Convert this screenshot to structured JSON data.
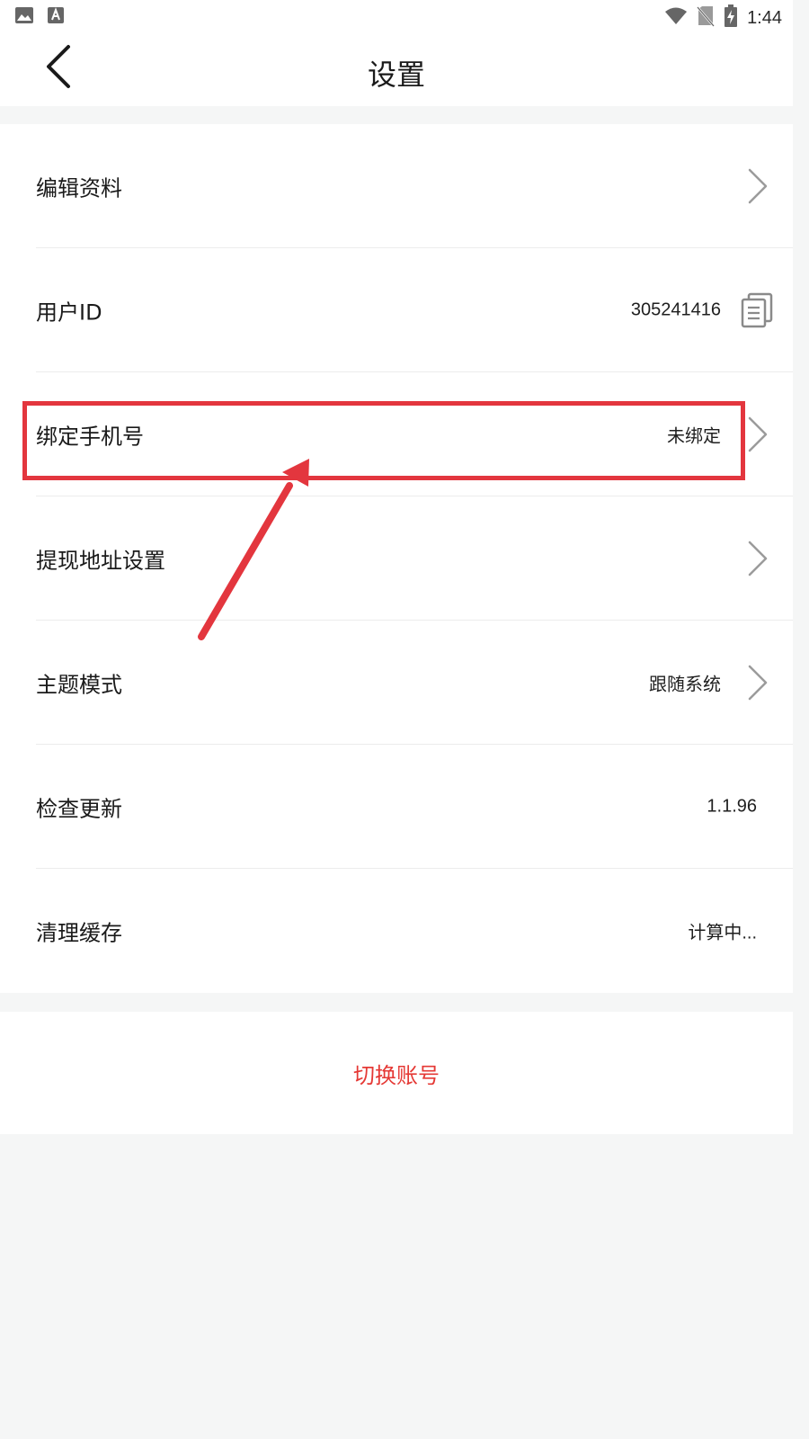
{
  "status_bar": {
    "time": "1:44",
    "left_icons": [
      "image-icon",
      "text-a-icon"
    ],
    "right_icons": [
      "wifi-icon",
      "no-sim-icon",
      "battery-charging-icon"
    ]
  },
  "header": {
    "title": "设置",
    "back_icon": "chevron-left-icon"
  },
  "settings": {
    "items": [
      {
        "label": "编辑资料",
        "value": "",
        "trailing": "chevron-right-icon"
      },
      {
        "label": "用户ID",
        "value": "305241416",
        "trailing": "copy-icon"
      },
      {
        "label": "绑定手机号",
        "value": "未绑定",
        "trailing": "chevron-right-icon"
      },
      {
        "label": "提现地址设置",
        "value": "",
        "trailing": "chevron-right-icon"
      },
      {
        "label": "主题模式",
        "value": "跟随系统",
        "trailing": "chevron-right-icon"
      },
      {
        "label": "检查更新",
        "value": "1.1.96",
        "trailing": ""
      },
      {
        "label": "清理缓存",
        "value": "计算中...",
        "trailing": ""
      }
    ]
  },
  "switch_account": {
    "label": "切换账号",
    "color": "#e53935"
  },
  "annotation": {
    "highlight_color": "#e3363e",
    "highlighted_item": "绑定手机号"
  }
}
